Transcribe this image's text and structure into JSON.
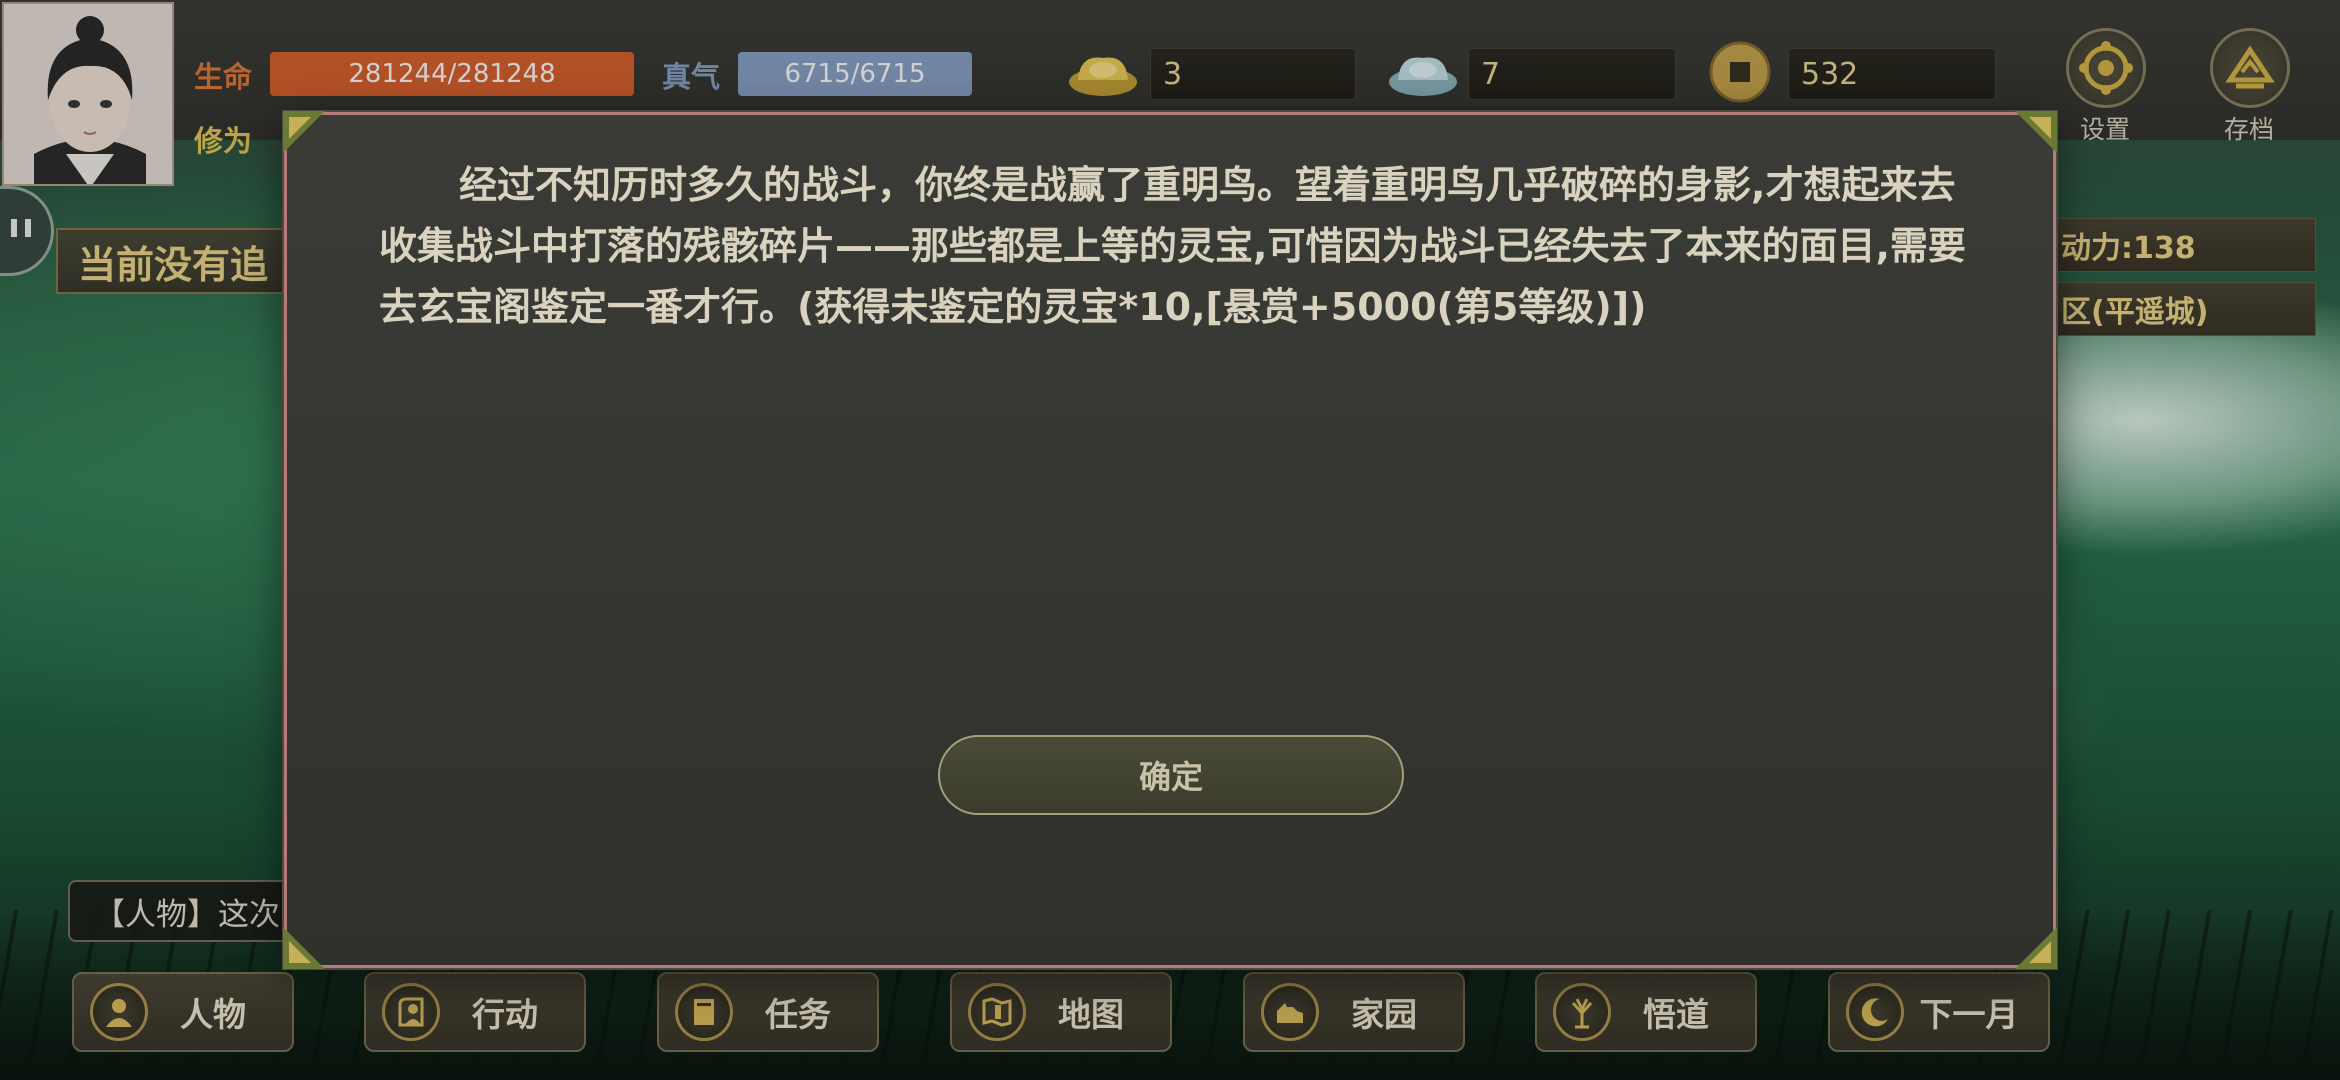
{
  "player": {
    "hp_label": "生命",
    "hp_value": "281244/281248",
    "hp_fraction": 0.99998,
    "qi_label": "真气",
    "qi_value": "6715/6715",
    "qi_fraction": 1.0,
    "cultivation_label": "修为"
  },
  "resources": {
    "gold_ingot": "3",
    "silver_ingot": "7",
    "coins": "532"
  },
  "top_buttons": {
    "settings": "设置",
    "save": "存档"
  },
  "left_panel": {
    "quest_banner": "当前没有追",
    "log_text": "【人物】这次"
  },
  "right_panel": {
    "action_power": "动力:138",
    "region": "区(平遥城)"
  },
  "dialog": {
    "message": "经过不知历时多久的战斗，你终是战赢了重明鸟。望着重明鸟几乎破碎的身影,才想起来去收集战斗中打落的残骸碎片——那些都是上等的灵宝,可惜因为战斗已经失去了本来的面目,需要去玄宝阁鉴定一番才行。(获得未鉴定的灵宝*10,[悬赏+5000(第5等级)])",
    "confirm": "确定"
  },
  "nav": [
    {
      "label": "人物",
      "icon": "person-icon"
    },
    {
      "label": "行动",
      "icon": "action-icon"
    },
    {
      "label": "任务",
      "icon": "book-icon"
    },
    {
      "label": "地图",
      "icon": "map-icon"
    },
    {
      "label": "家园",
      "icon": "home-icon"
    },
    {
      "label": "悟道",
      "icon": "tree-icon"
    },
    {
      "label": "下一月",
      "icon": "moon-icon"
    }
  ],
  "colors": {
    "hp_bar": "#d9622f",
    "qi_bar": "#8aa3c9",
    "gold_text": "#ecd89a",
    "dialog_border": "#b77a7a"
  }
}
